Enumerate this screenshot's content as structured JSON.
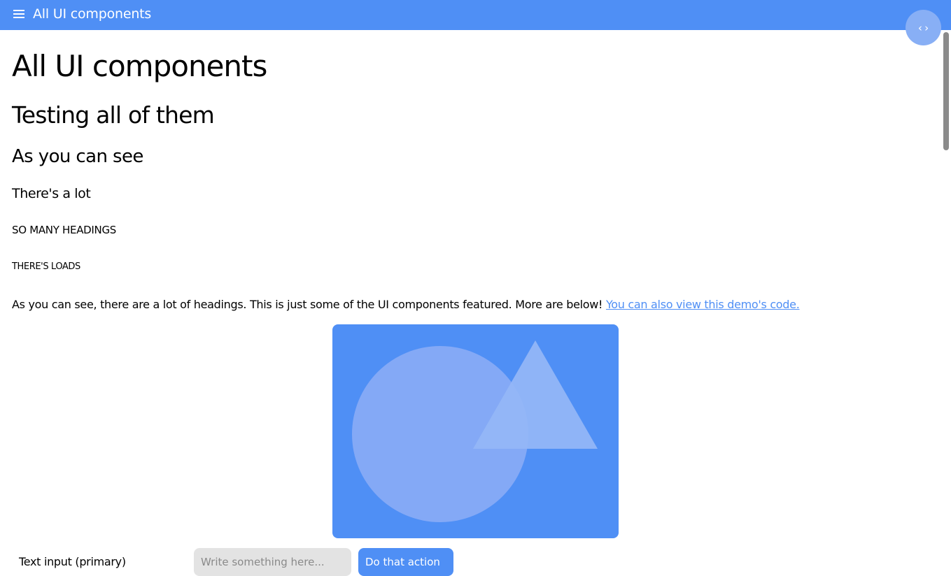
{
  "topbar": {
    "title": "All UI components",
    "menu_icon": "hamburger-menu-icon",
    "background": "#4f8ff5"
  },
  "fab": {
    "icon": "code-icon",
    "glyph": "‹›"
  },
  "headings": {
    "h1": "All UI components",
    "h2": "Testing all of them",
    "h3": "As you can see",
    "h4": "There's a lot",
    "h5": "SO MANY HEADINGS",
    "h6": "THERE'S LOADS"
  },
  "paragraph": {
    "text": "As you can see, there are a lot of headings. This is just some of the UI components featured. More are below! ",
    "link_text": "You can also view this demo's code."
  },
  "illustration": {
    "icon": "placeholder-shapes-image",
    "background": "#4f8ff5",
    "circle_color": "#84a9f6",
    "triangle_color": "#95b7f6"
  },
  "form": {
    "label": "Text input (primary)",
    "input_placeholder": "Write something here...",
    "input_value": "",
    "button_label": "Do that action"
  }
}
